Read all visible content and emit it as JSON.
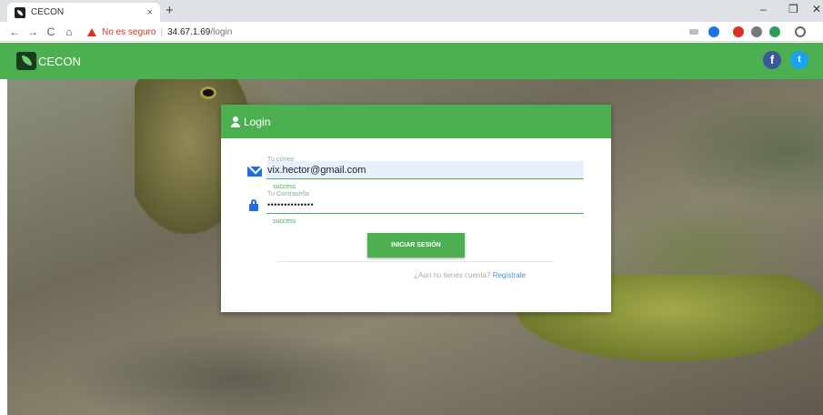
{
  "browser": {
    "tab_title": "CECON",
    "tab_close": "×",
    "new_tab": "+",
    "security_label": "No es seguro",
    "url_host": "34.67.1.69",
    "url_path": "/login",
    "nav": {
      "back": "←",
      "forward": "→",
      "reload": "C",
      "home": "⌂"
    },
    "window": {
      "minimize": "–",
      "maximize": "❐",
      "close": "✕"
    }
  },
  "app": {
    "brand": "CECON",
    "social": {
      "facebook": "f",
      "twitter": "t"
    }
  },
  "login": {
    "title": "Login",
    "email_label": "Tu correo",
    "email_value": "vix.hector@gmail.com",
    "email_help": "success",
    "password_label": "Tu Contraseña",
    "password_value": "••••••••••••••",
    "password_help": "success",
    "submit": "INICIAR SESIÓN",
    "register_prompt": "¿Aún no tienes cuenta?",
    "register_link": "Registrate"
  },
  "colors": {
    "primary_green": "#4caf50",
    "link_blue": "#4a90d9",
    "warning_red": "#d93025"
  }
}
